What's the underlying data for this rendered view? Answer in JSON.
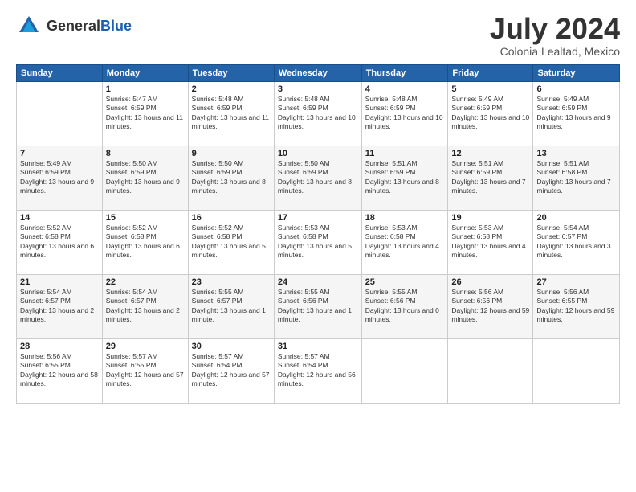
{
  "logo": {
    "general": "General",
    "blue": "Blue"
  },
  "header": {
    "month": "July 2024",
    "location": "Colonia Lealtad, Mexico"
  },
  "days_of_week": [
    "Sunday",
    "Monday",
    "Tuesday",
    "Wednesday",
    "Thursday",
    "Friday",
    "Saturday"
  ],
  "weeks": [
    [
      {
        "day": "",
        "sunrise": "",
        "sunset": "",
        "daylight": ""
      },
      {
        "day": "1",
        "sunrise": "Sunrise: 5:47 AM",
        "sunset": "Sunset: 6:59 PM",
        "daylight": "Daylight: 13 hours and 11 minutes."
      },
      {
        "day": "2",
        "sunrise": "Sunrise: 5:48 AM",
        "sunset": "Sunset: 6:59 PM",
        "daylight": "Daylight: 13 hours and 11 minutes."
      },
      {
        "day": "3",
        "sunrise": "Sunrise: 5:48 AM",
        "sunset": "Sunset: 6:59 PM",
        "daylight": "Daylight: 13 hours and 10 minutes."
      },
      {
        "day": "4",
        "sunrise": "Sunrise: 5:48 AM",
        "sunset": "Sunset: 6:59 PM",
        "daylight": "Daylight: 13 hours and 10 minutes."
      },
      {
        "day": "5",
        "sunrise": "Sunrise: 5:49 AM",
        "sunset": "Sunset: 6:59 PM",
        "daylight": "Daylight: 13 hours and 10 minutes."
      },
      {
        "day": "6",
        "sunrise": "Sunrise: 5:49 AM",
        "sunset": "Sunset: 6:59 PM",
        "daylight": "Daylight: 13 hours and 9 minutes."
      }
    ],
    [
      {
        "day": "7",
        "sunrise": "Sunrise: 5:49 AM",
        "sunset": "Sunset: 6:59 PM",
        "daylight": "Daylight: 13 hours and 9 minutes."
      },
      {
        "day": "8",
        "sunrise": "Sunrise: 5:50 AM",
        "sunset": "Sunset: 6:59 PM",
        "daylight": "Daylight: 13 hours and 9 minutes."
      },
      {
        "day": "9",
        "sunrise": "Sunrise: 5:50 AM",
        "sunset": "Sunset: 6:59 PM",
        "daylight": "Daylight: 13 hours and 8 minutes."
      },
      {
        "day": "10",
        "sunrise": "Sunrise: 5:50 AM",
        "sunset": "Sunset: 6:59 PM",
        "daylight": "Daylight: 13 hours and 8 minutes."
      },
      {
        "day": "11",
        "sunrise": "Sunrise: 5:51 AM",
        "sunset": "Sunset: 6:59 PM",
        "daylight": "Daylight: 13 hours and 8 minutes."
      },
      {
        "day": "12",
        "sunrise": "Sunrise: 5:51 AM",
        "sunset": "Sunset: 6:59 PM",
        "daylight": "Daylight: 13 hours and 7 minutes."
      },
      {
        "day": "13",
        "sunrise": "Sunrise: 5:51 AM",
        "sunset": "Sunset: 6:58 PM",
        "daylight": "Daylight: 13 hours and 7 minutes."
      }
    ],
    [
      {
        "day": "14",
        "sunrise": "Sunrise: 5:52 AM",
        "sunset": "Sunset: 6:58 PM",
        "daylight": "Daylight: 13 hours and 6 minutes."
      },
      {
        "day": "15",
        "sunrise": "Sunrise: 5:52 AM",
        "sunset": "Sunset: 6:58 PM",
        "daylight": "Daylight: 13 hours and 6 minutes."
      },
      {
        "day": "16",
        "sunrise": "Sunrise: 5:52 AM",
        "sunset": "Sunset: 6:58 PM",
        "daylight": "Daylight: 13 hours and 5 minutes."
      },
      {
        "day": "17",
        "sunrise": "Sunrise: 5:53 AM",
        "sunset": "Sunset: 6:58 PM",
        "daylight": "Daylight: 13 hours and 5 minutes."
      },
      {
        "day": "18",
        "sunrise": "Sunrise: 5:53 AM",
        "sunset": "Sunset: 6:58 PM",
        "daylight": "Daylight: 13 hours and 4 minutes."
      },
      {
        "day": "19",
        "sunrise": "Sunrise: 5:53 AM",
        "sunset": "Sunset: 6:58 PM",
        "daylight": "Daylight: 13 hours and 4 minutes."
      },
      {
        "day": "20",
        "sunrise": "Sunrise: 5:54 AM",
        "sunset": "Sunset: 6:57 PM",
        "daylight": "Daylight: 13 hours and 3 minutes."
      }
    ],
    [
      {
        "day": "21",
        "sunrise": "Sunrise: 5:54 AM",
        "sunset": "Sunset: 6:57 PM",
        "daylight": "Daylight: 13 hours and 2 minutes."
      },
      {
        "day": "22",
        "sunrise": "Sunrise: 5:54 AM",
        "sunset": "Sunset: 6:57 PM",
        "daylight": "Daylight: 13 hours and 2 minutes."
      },
      {
        "day": "23",
        "sunrise": "Sunrise: 5:55 AM",
        "sunset": "Sunset: 6:57 PM",
        "daylight": "Daylight: 13 hours and 1 minute."
      },
      {
        "day": "24",
        "sunrise": "Sunrise: 5:55 AM",
        "sunset": "Sunset: 6:56 PM",
        "daylight": "Daylight: 13 hours and 1 minute."
      },
      {
        "day": "25",
        "sunrise": "Sunrise: 5:55 AM",
        "sunset": "Sunset: 6:56 PM",
        "daylight": "Daylight: 13 hours and 0 minutes."
      },
      {
        "day": "26",
        "sunrise": "Sunrise: 5:56 AM",
        "sunset": "Sunset: 6:56 PM",
        "daylight": "Daylight: 12 hours and 59 minutes."
      },
      {
        "day": "27",
        "sunrise": "Sunrise: 5:56 AM",
        "sunset": "Sunset: 6:55 PM",
        "daylight": "Daylight: 12 hours and 59 minutes."
      }
    ],
    [
      {
        "day": "28",
        "sunrise": "Sunrise: 5:56 AM",
        "sunset": "Sunset: 6:55 PM",
        "daylight": "Daylight: 12 hours and 58 minutes."
      },
      {
        "day": "29",
        "sunrise": "Sunrise: 5:57 AM",
        "sunset": "Sunset: 6:55 PM",
        "daylight": "Daylight: 12 hours and 57 minutes."
      },
      {
        "day": "30",
        "sunrise": "Sunrise: 5:57 AM",
        "sunset": "Sunset: 6:54 PM",
        "daylight": "Daylight: 12 hours and 57 minutes."
      },
      {
        "day": "31",
        "sunrise": "Sunrise: 5:57 AM",
        "sunset": "Sunset: 6:54 PM",
        "daylight": "Daylight: 12 hours and 56 minutes."
      },
      {
        "day": "",
        "sunrise": "",
        "sunset": "",
        "daylight": ""
      },
      {
        "day": "",
        "sunrise": "",
        "sunset": "",
        "daylight": ""
      },
      {
        "day": "",
        "sunrise": "",
        "sunset": "",
        "daylight": ""
      }
    ]
  ]
}
